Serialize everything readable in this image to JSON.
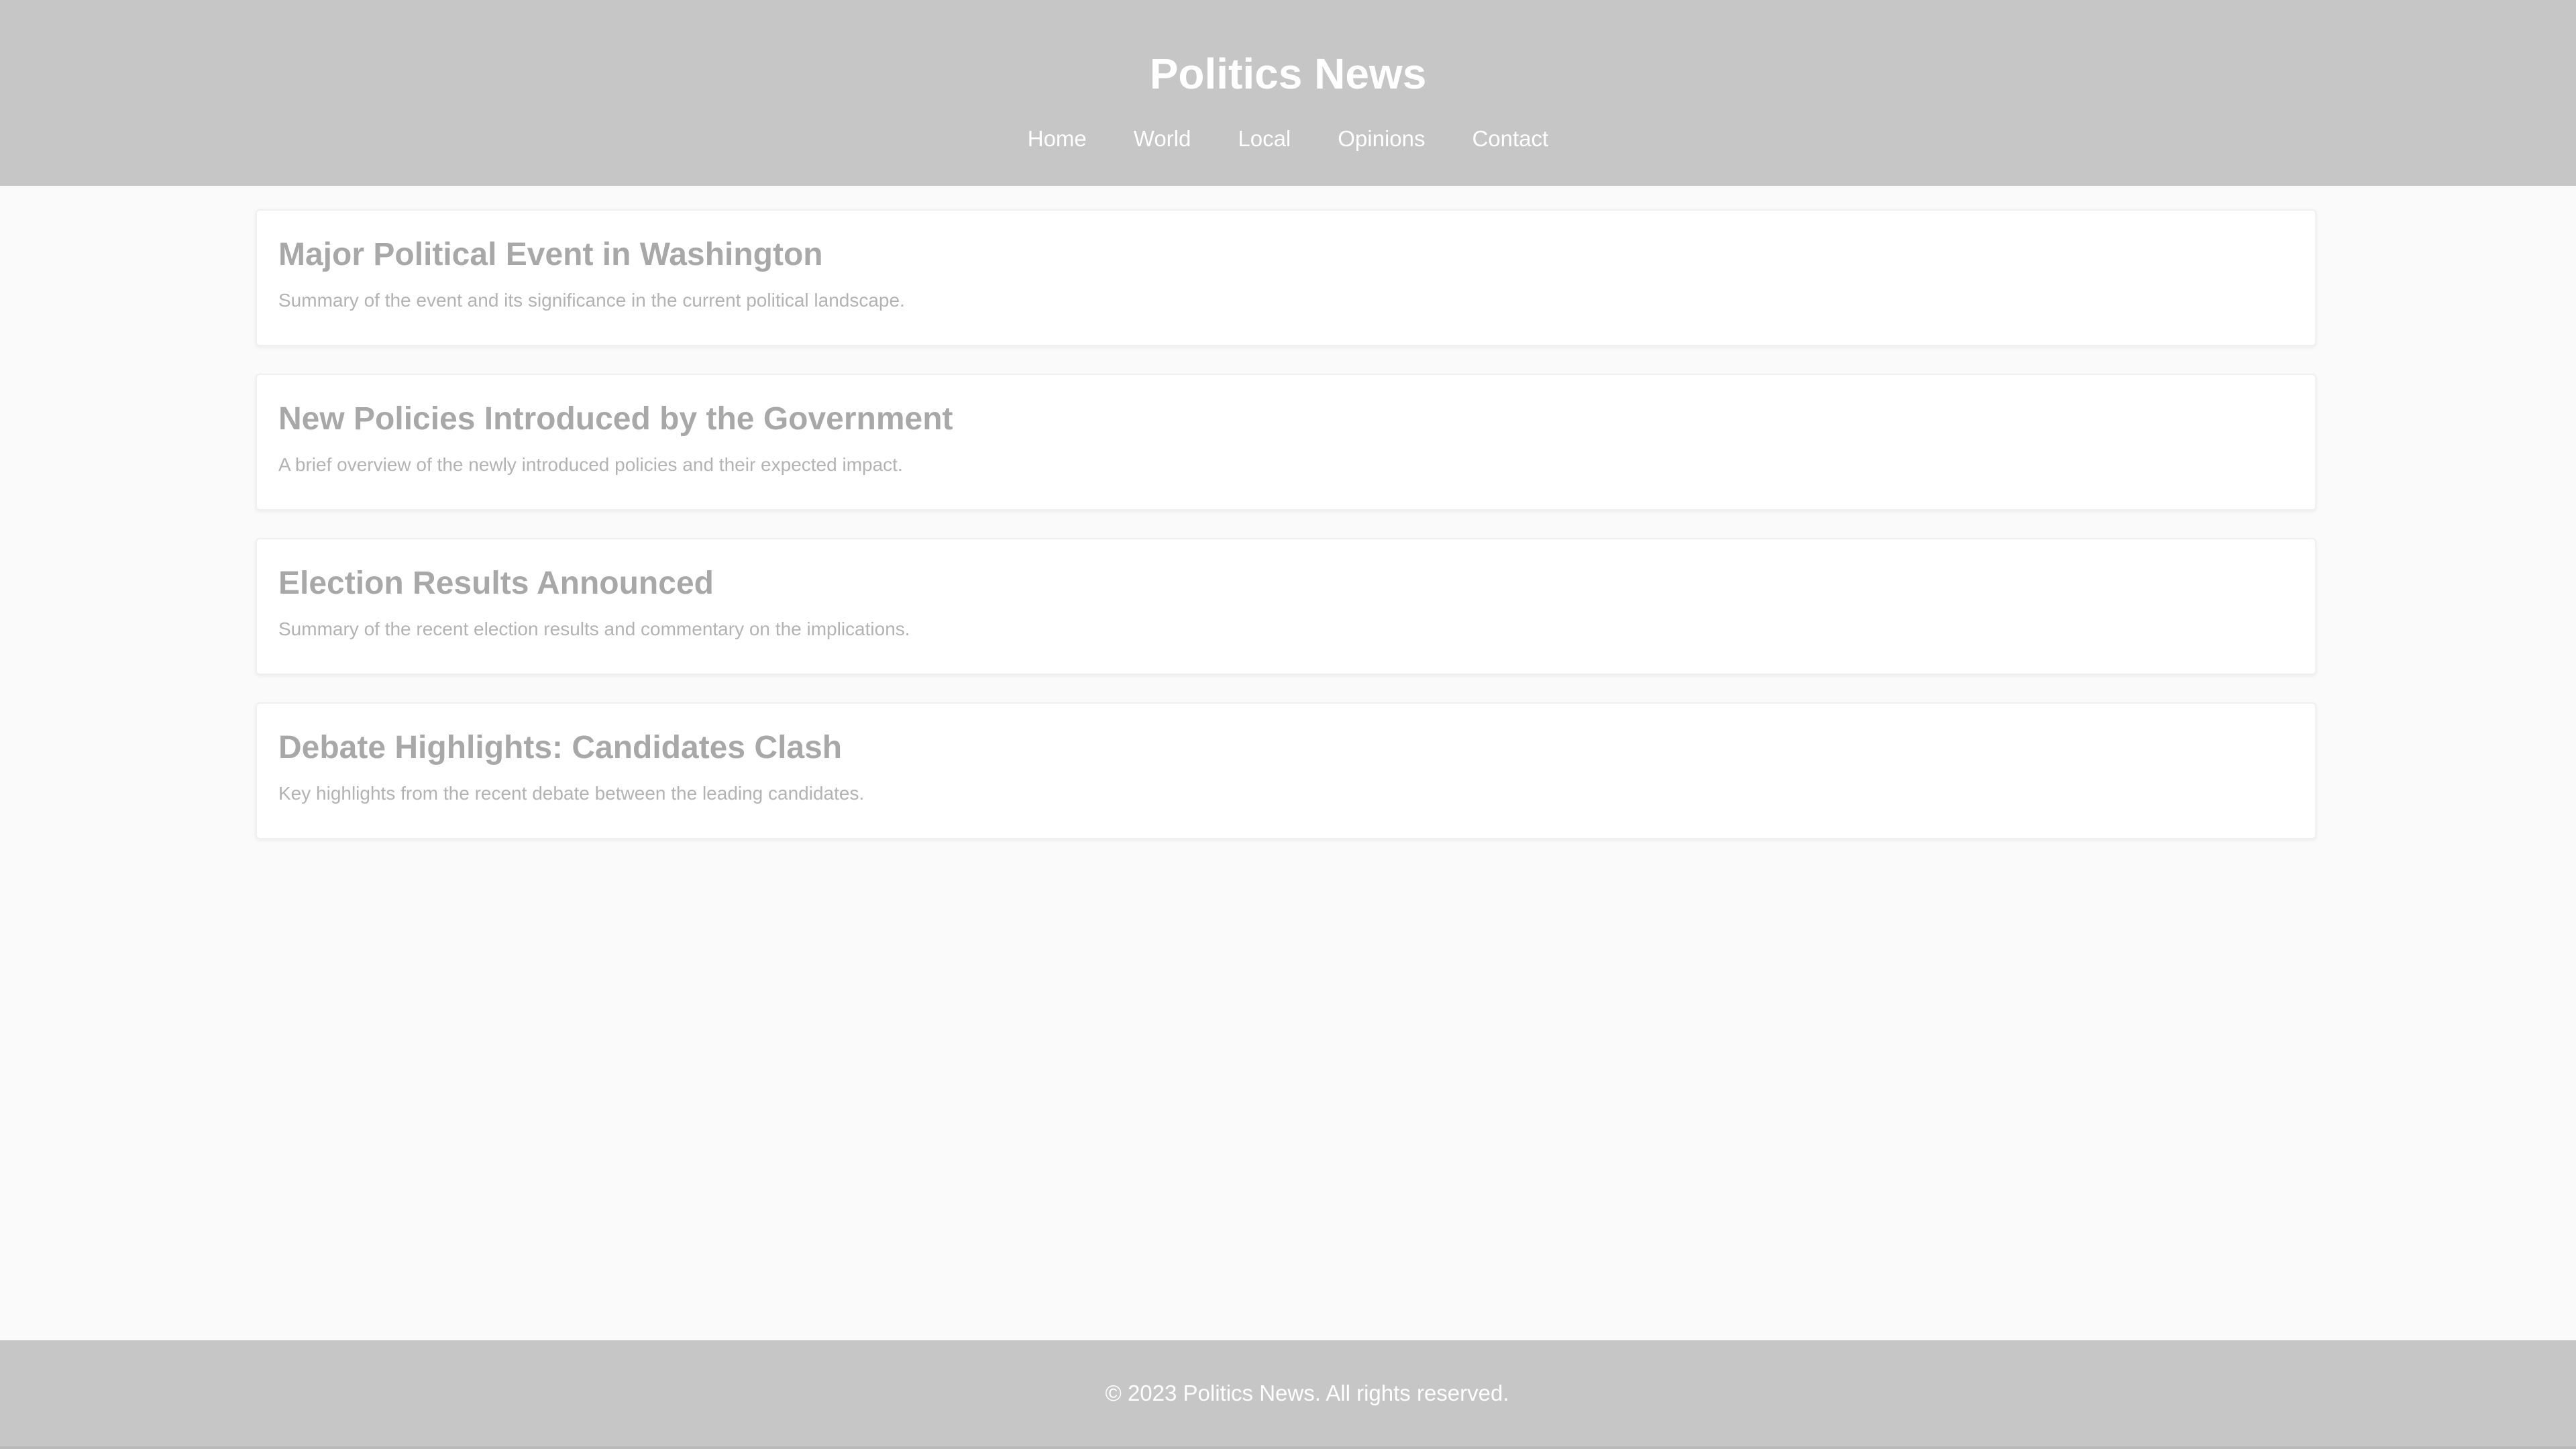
{
  "header": {
    "title": "Politics News",
    "nav": [
      "Home",
      "World",
      "Local",
      "Opinions",
      "Contact"
    ]
  },
  "articles": [
    {
      "title": "Major Political Event in Washington",
      "summary": "Summary of the event and its significance in the current political landscape."
    },
    {
      "title": "New Policies Introduced by the Government",
      "summary": "A brief overview of the newly introduced policies and their expected impact."
    },
    {
      "title": "Election Results Announced",
      "summary": "Summary of the recent election results and commentary on the implications."
    },
    {
      "title": "Debate Highlights: Candidates Clash",
      "summary": "Key highlights from the recent debate between the leading candidates."
    }
  ],
  "footer": {
    "text": "© 2023 Politics News. All rights reserved."
  },
  "colors": {
    "header_bg": "#c6c6c6",
    "page_bg": "#fafafa",
    "card_bg": "#ffffff",
    "title_text": "#a8a8a8",
    "summary_text": "#b3b3b3"
  }
}
